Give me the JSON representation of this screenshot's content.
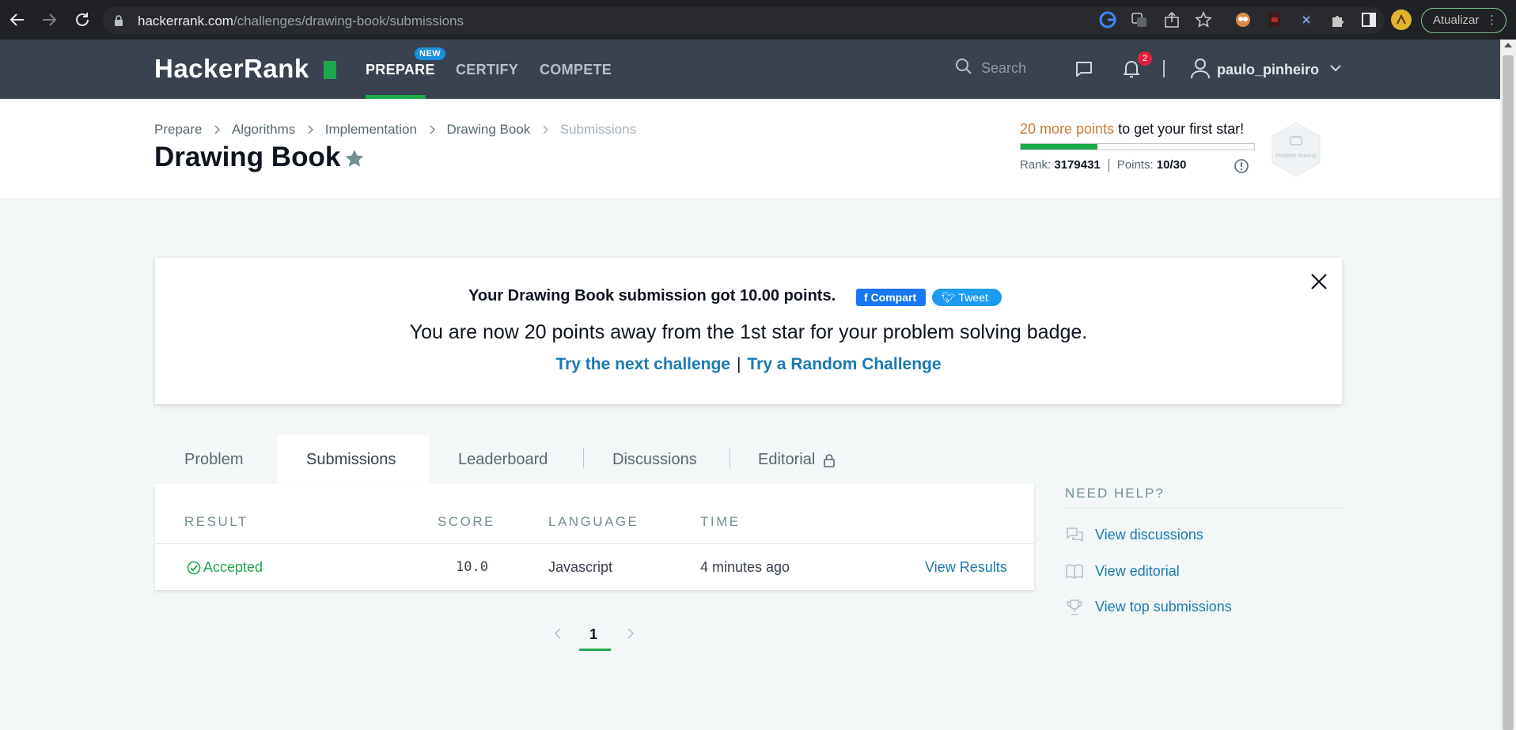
{
  "browser": {
    "url_host": "hackerrank.com",
    "url_path": "/challenges/drawing-book/submissions",
    "update_label": "Atualizar"
  },
  "nav": {
    "logo": "HackerRank",
    "links": [
      "PREPARE",
      "CERTIFY",
      "COMPETE"
    ],
    "new_badge": "NEW",
    "search_placeholder": "Search",
    "notification_count": "2",
    "username": "paulo_pinheiro"
  },
  "header": {
    "breadcrumbs": [
      "Prepare",
      "Algorithms",
      "Implementation",
      "Drawing Book",
      "Submissions"
    ],
    "title": "Drawing Book",
    "points_highlight": "20 more points",
    "points_rest": " to get your first star!",
    "progress_fraction": 0.33,
    "rank_label": "Rank:",
    "rank_value": "3179431",
    "points_label": "Points:",
    "points_value": "10/30",
    "badge_label": "Problem Solving"
  },
  "banner": {
    "line1": "Your Drawing Book submission got 10.00 points.",
    "facebook_label": "Compart",
    "tweet_label": "Tweet",
    "line2": "You are now 20 points away from the 1st star for your problem solving badge.",
    "next_link": "Try the next challenge",
    "separator": "|",
    "random_link": "Try a Random Challenge"
  },
  "tabs": [
    "Problem",
    "Submissions",
    "Leaderboard",
    "Discussions",
    "Editorial"
  ],
  "table": {
    "headers": [
      "RESULT",
      "SCORE",
      "LANGUAGE",
      "TIME"
    ],
    "rows": [
      {
        "result": "Accepted",
        "score": "10.0",
        "language": "Javascript",
        "time": "4 minutes ago",
        "action": "View Results"
      }
    ]
  },
  "pagination": {
    "current": "1"
  },
  "help": {
    "title": "NEED HELP?",
    "items": [
      "View discussions",
      "View editorial",
      "View top submissions"
    ]
  },
  "colors": {
    "brand_green": "#1ba94c",
    "nav_bg": "#39424e",
    "link_blue": "#1a7ab1",
    "points_orange": "#cc7b38"
  }
}
